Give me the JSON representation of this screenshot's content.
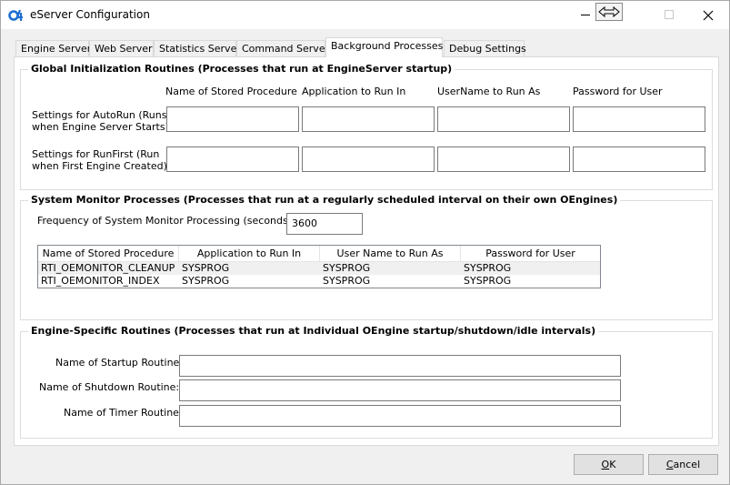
{
  "window": {
    "title": "eServer Configuration",
    "icon": "o4-logo-icon",
    "accent_color": "#1e6fd1"
  },
  "tabs": [
    {
      "label": "Engine Server",
      "active": false
    },
    {
      "label": "Web Server",
      "active": false
    },
    {
      "label": "Statistics Server",
      "active": false
    },
    {
      "label": "Command Server",
      "active": false
    },
    {
      "label": "Background Processes",
      "active": true
    },
    {
      "label": "Debug Settings",
      "active": false
    }
  ],
  "global_init": {
    "title": "Global Initialization Routines (Processes that run at EngineServer startup)",
    "columns": {
      "proc": "Name of Stored Procedure",
      "app": "Application to Run In",
      "user": "UserName to Run As",
      "password": "Password for User"
    },
    "autorun_label_1": "Settings for AutoRun (Runs",
    "autorun_label_2": "when Engine Server Starts):",
    "runfirst_label_1": "Settings for RunFirst (Run",
    "runfirst_label_2": "when First Engine Created):",
    "autorun": {
      "proc": "",
      "app": "",
      "user": "",
      "password": ""
    },
    "runfirst": {
      "proc": "",
      "app": "",
      "user": "",
      "password": ""
    }
  },
  "system_monitor": {
    "title": "System Monitor Processes (Processes that run at a regularly scheduled interval on their own OEngines)",
    "frequency_label": "Frequency of System Monitor Processing (seconds):",
    "frequency_value": "3600",
    "grid": {
      "headers": [
        "Name of Stored Procedure",
        "Application to Run In",
        "User Name to Run As",
        "Password for User"
      ],
      "rows": [
        [
          "RTI_OEMONITOR_CLEANUP",
          "SYSPROG",
          "SYSPROG",
          "SYSPROG"
        ],
        [
          "RTI_OEMONITOR_INDEX",
          "SYSPROG",
          "SYSPROG",
          "SYSPROG"
        ]
      ]
    }
  },
  "engine_specific": {
    "title": "Engine-Specific Routines (Processes that run at Individual OEngine startup/shutdown/idle intervals)",
    "startup_label": "Name of Startup Routine:",
    "shutdown_label": "Name of Shutdown Routine:",
    "timer_label": "Name of Timer Routine:",
    "startup_value": "",
    "shutdown_value": "",
    "timer_value": ""
  },
  "buttons": {
    "ok_mnemonic": "O",
    "ok_rest": "K",
    "cancel_mnemonic": "C",
    "cancel_rest": "ancel"
  }
}
